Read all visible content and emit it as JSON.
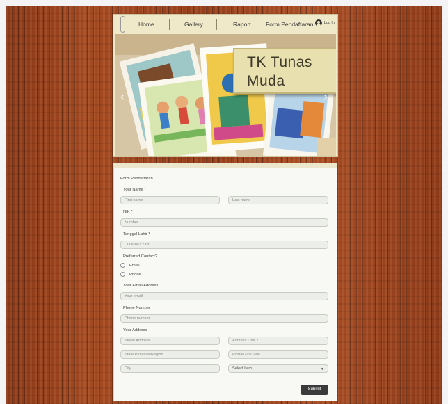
{
  "nav": {
    "home": "Home",
    "gallery": "Gallery",
    "raport": "Raport",
    "form": "Form Pendaftaran",
    "login": "Log In"
  },
  "hero": {
    "title_line1": "TK Tunas",
    "title_line2": "Muda",
    "prev_icon": "chevron-left-icon",
    "next_icon": "chevron-right-icon"
  },
  "form": {
    "heading": "Form Pendaftaran",
    "name_label": "Your Name *",
    "first_name_placeholder": "First name",
    "last_name_placeholder": "Last name",
    "nik_label": "NIK *",
    "nik_placeholder": "Number",
    "dob_label": "Tanggal Lahir *",
    "dob_placeholder": "DD-MM-YYYY",
    "contact_label": "Preferred Contact?",
    "contact_options": [
      "Email",
      "Phone"
    ],
    "email_label": "Your Email Address",
    "email_placeholder": "Your email",
    "phone_label": "Phone Number",
    "phone_placeholder": "Phone number",
    "address_label": "Your Address",
    "street_placeholder": "Street Address",
    "address2_placeholder": "Address Line 2",
    "state_placeholder": "State/Province/Region",
    "postal_placeholder": "Postal/Zip Code",
    "city_placeholder": "City",
    "select_placeholder": "Select Item",
    "submit_label": "Submit"
  },
  "colors": {
    "wood": "#9a4420",
    "header_bg": "#efe8c9",
    "title_card": "#e9e0b0",
    "submit_bg": "#3a3a3a"
  }
}
